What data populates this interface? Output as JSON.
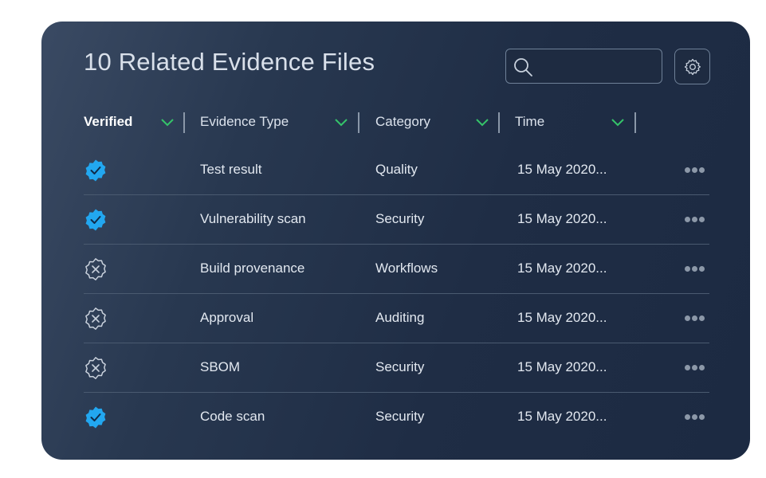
{
  "title": "10 Related Evidence Files",
  "search": {
    "value": "",
    "placeholder": ""
  },
  "columns": [
    {
      "label": "Verified"
    },
    {
      "label": "Evidence Type"
    },
    {
      "label": "Category"
    },
    {
      "label": "Time"
    }
  ],
  "rows": [
    {
      "verified": true,
      "type": "Test result",
      "category": "Quality",
      "time": "15 May 2020..."
    },
    {
      "verified": true,
      "type": "Vulnerability scan",
      "category": "Security",
      "time": "15 May 2020..."
    },
    {
      "verified": false,
      "type": "Build provenance",
      "category": "Workflows",
      "time": "15 May 2020..."
    },
    {
      "verified": false,
      "type": "Approval",
      "category": "Auditing",
      "time": "15 May 2020..."
    },
    {
      "verified": false,
      "type": "SBOM",
      "category": "Security",
      "time": "15 May 2020..."
    },
    {
      "verified": true,
      "type": "Code scan",
      "category": "Security",
      "time": "15 May 2020..."
    }
  ],
  "colors": {
    "verified_badge": "#22a7f0",
    "chevron": "#35c46a",
    "unverified_badge": "#c9d1dc"
  },
  "icons": {
    "verified": "verified-badge-icon",
    "unverified": "unverified-badge-icon",
    "search": "search-icon",
    "settings": "gear-icon",
    "sort": "chevron-down-icon",
    "more": "more-options-icon"
  }
}
